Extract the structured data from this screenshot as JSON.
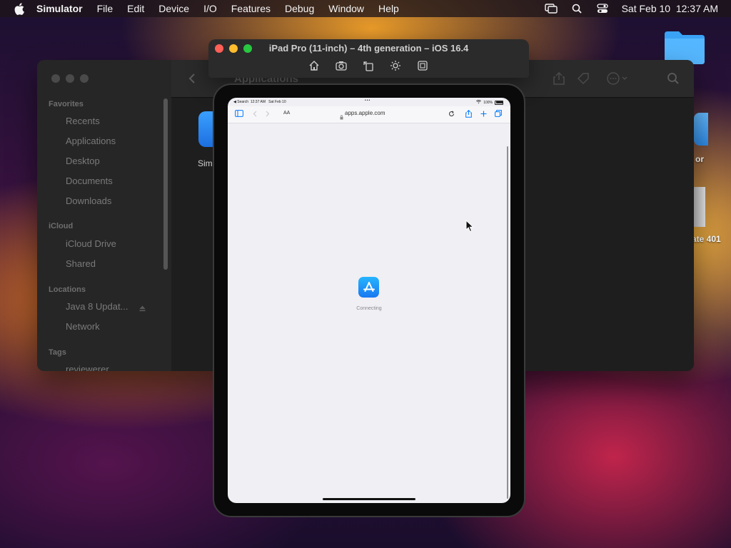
{
  "menubar": {
    "app_name": "Simulator",
    "menus": [
      "File",
      "Edit",
      "Device",
      "I/O",
      "Features",
      "Debug",
      "Window",
      "Help"
    ],
    "clock": "Sat Feb 10  12:37 AM",
    "status_icons": [
      "screen-mirroring-icon",
      "spotlight-search-icon",
      "control-center-icon"
    ]
  },
  "desktop": {
    "label_1": "or",
    "label_2": "ate 401"
  },
  "finder": {
    "title": "Applications",
    "sidebar": {
      "favorites_header": "Favorites",
      "favorites": [
        "Recents",
        "Applications",
        "Desktop",
        "Documents",
        "Downloads"
      ],
      "icloud_header": "iCloud",
      "icloud": [
        "iCloud Drive",
        "Shared"
      ],
      "locations_header": "Locations",
      "locations": [
        "Java 8 Updat...",
        "Network"
      ],
      "tags_header": "Tags",
      "tags_partial": "reviewerer"
    },
    "content_label_partial": "Sim"
  },
  "simulator": {
    "title": "iPad Pro (11-inch) – 4th generation – iOS 16.4",
    "toolbar_icons": [
      "home-icon",
      "screenshot-icon",
      "rotate-icon",
      "appearance-icon",
      "bezel-icon"
    ]
  },
  "ipad": {
    "status_left": "◀ Search  12:37 AM   Sat Feb 10",
    "status_center": "•••",
    "status_battery": "100%",
    "url": "apps.apple.com",
    "text_size_label": "AA",
    "loading_text": "Connecting"
  },
  "colors": {
    "traffic_red": "#fe5f57",
    "traffic_yellow": "#febc2e",
    "traffic_green": "#28c840",
    "ios_blue": "#007aff"
  }
}
